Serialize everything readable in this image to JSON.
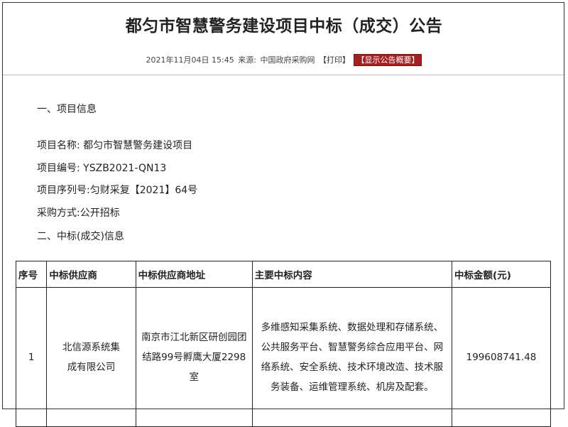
{
  "page": {
    "title": "都匀市智慧警务建设项目中标（成交）公告",
    "meta": {
      "date": "2021年11月04日 15:45",
      "source_label": "来源:",
      "source": "中国政府采购网",
      "print": "【打印】",
      "summary": "【显示公告概要】"
    },
    "section1": "一、项目信息",
    "project_name": "项目名称: 都匀市智慧警务建设项目",
    "project_code": "项目编号: YSZB2021-QN13",
    "project_serial": "项目序列号:匀财采复【2021】64号",
    "purchase_method": "采购方式:公开招标",
    "section2": "二、中标(成交)信息",
    "table": {
      "headers": [
        "序号",
        "中标供应商",
        "中标供应商地址",
        "主要中标内容",
        "中标金额(元)"
      ],
      "rows": [
        [
          "1",
          "北信源系统集成有限公司",
          "南京市江北新区研创园团结路99号孵鹰大厦2298室",
          "多维感知采集系统、数据处理和存储系统、公共服务平台、智慧警务综合应用平台、网络系统、安全系统、技术环境改造、技术服务装备、运维管理系统、机房及配套。",
          "199608741.48"
        ]
      ]
    }
  }
}
